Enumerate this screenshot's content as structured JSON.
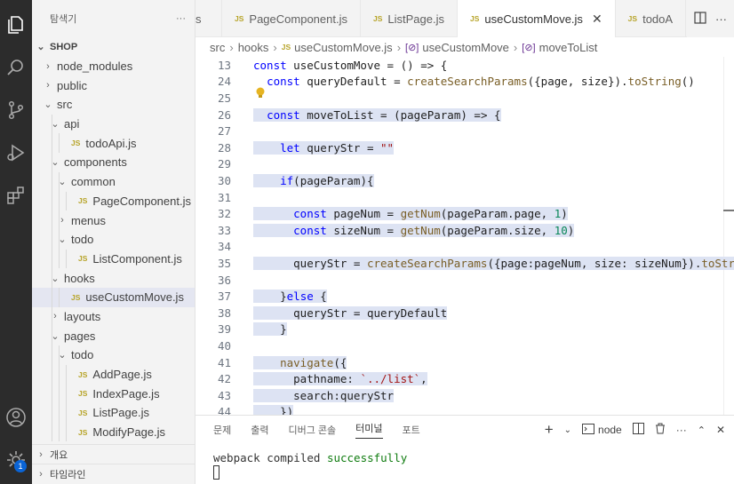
{
  "sidebar": {
    "title": "탐색기",
    "more": "···",
    "root": "SHOP",
    "items": [
      {
        "label": "node_modules",
        "type": "folder",
        "open": false,
        "depth": 1
      },
      {
        "label": "public",
        "type": "folder",
        "open": false,
        "depth": 1
      },
      {
        "label": "src",
        "type": "folder",
        "open": true,
        "depth": 1
      },
      {
        "label": "api",
        "type": "folder",
        "open": true,
        "depth": 2
      },
      {
        "label": "todoApi.js",
        "type": "js",
        "depth": 3
      },
      {
        "label": "components",
        "type": "folder",
        "open": true,
        "depth": 2
      },
      {
        "label": "common",
        "type": "folder",
        "open": true,
        "depth": 3
      },
      {
        "label": "PageComponent.js",
        "type": "js",
        "depth": 4
      },
      {
        "label": "menus",
        "type": "folder",
        "open": false,
        "depth": 3
      },
      {
        "label": "todo",
        "type": "folder",
        "open": true,
        "depth": 3
      },
      {
        "label": "ListComponent.js",
        "type": "js",
        "depth": 4
      },
      {
        "label": "hooks",
        "type": "folder",
        "open": true,
        "depth": 2
      },
      {
        "label": "useCustomMove.js",
        "type": "js",
        "depth": 3,
        "active": true
      },
      {
        "label": "layouts",
        "type": "folder",
        "open": false,
        "depth": 2
      },
      {
        "label": "pages",
        "type": "folder",
        "open": true,
        "depth": 2
      },
      {
        "label": "todo",
        "type": "folder",
        "open": true,
        "depth": 3
      },
      {
        "label": "AddPage.js",
        "type": "js",
        "depth": 4
      },
      {
        "label": "IndexPage.js",
        "type": "js",
        "depth": 4
      },
      {
        "label": "ListPage.js",
        "type": "js",
        "depth": 4
      },
      {
        "label": "ModifyPage.js",
        "type": "js",
        "depth": 4
      }
    ],
    "footer": [
      {
        "label": "개요"
      },
      {
        "label": "타임라인"
      }
    ]
  },
  "tabs": [
    {
      "label": "s",
      "icon": ""
    },
    {
      "label": "PageComponent.js",
      "icon": "JS"
    },
    {
      "label": "ListPage.js",
      "icon": "JS"
    },
    {
      "label": "useCustomMove.js",
      "icon": "JS",
      "active": true,
      "close": "✕"
    },
    {
      "label": "todoA",
      "icon": "JS"
    }
  ],
  "breadcrumb": {
    "parts": [
      "src",
      "hooks"
    ],
    "file": "useCustomMove.js",
    "symbol1": "useCustomMove",
    "symbol2": "moveToList",
    "js_icon": "JS"
  },
  "editor": {
    "lines": [
      {
        "n": "13",
        "code": "const useCustomMove = () => {"
      },
      {
        "n": "24",
        "code": "  const queryDefault = createSearchParams({page, size}).toString()"
      },
      {
        "n": "25",
        "code": ""
      },
      {
        "n": "26",
        "code": "  const moveToList = (pageParam) => {"
      },
      {
        "n": "27",
        "code": ""
      },
      {
        "n": "28",
        "code": "    let queryStr = \"\""
      },
      {
        "n": "29",
        "code": ""
      },
      {
        "n": "30",
        "code": "    if(pageParam){"
      },
      {
        "n": "31",
        "code": ""
      },
      {
        "n": "32",
        "code": "      const pageNum = getNum(pageParam.page, 1)"
      },
      {
        "n": "33",
        "code": "      const sizeNum = getNum(pageParam.size, 10)"
      },
      {
        "n": "34",
        "code": ""
      },
      {
        "n": "35",
        "code": "      queryStr = createSearchParams({page:pageNum, size: sizeNum}).toString()"
      },
      {
        "n": "36",
        "code": ""
      },
      {
        "n": "37",
        "code": "    }else {"
      },
      {
        "n": "38",
        "code": "      queryStr = queryDefault"
      },
      {
        "n": "39",
        "code": "    }"
      },
      {
        "n": "40",
        "code": ""
      },
      {
        "n": "41",
        "code": "    navigate({"
      },
      {
        "n": "42",
        "code": "      pathname: `../list`,"
      },
      {
        "n": "43",
        "code": "      search:queryStr"
      },
      {
        "n": "44",
        "code": "    })"
      }
    ]
  },
  "panel": {
    "tabs": [
      "문제",
      "출력",
      "디버그 콘솔",
      "터미널",
      "포트"
    ],
    "active_tab": "터미널",
    "terminal_name": "node",
    "output_prefix": "webpack compiled ",
    "output_status": "successfully"
  },
  "activity": {
    "badge": "1"
  },
  "colors": {
    "accent": "#0a64d6",
    "keyword": "#0000ff",
    "function": "#795e26",
    "string": "#a31515",
    "number": "#098658",
    "success": "#107c10"
  }
}
